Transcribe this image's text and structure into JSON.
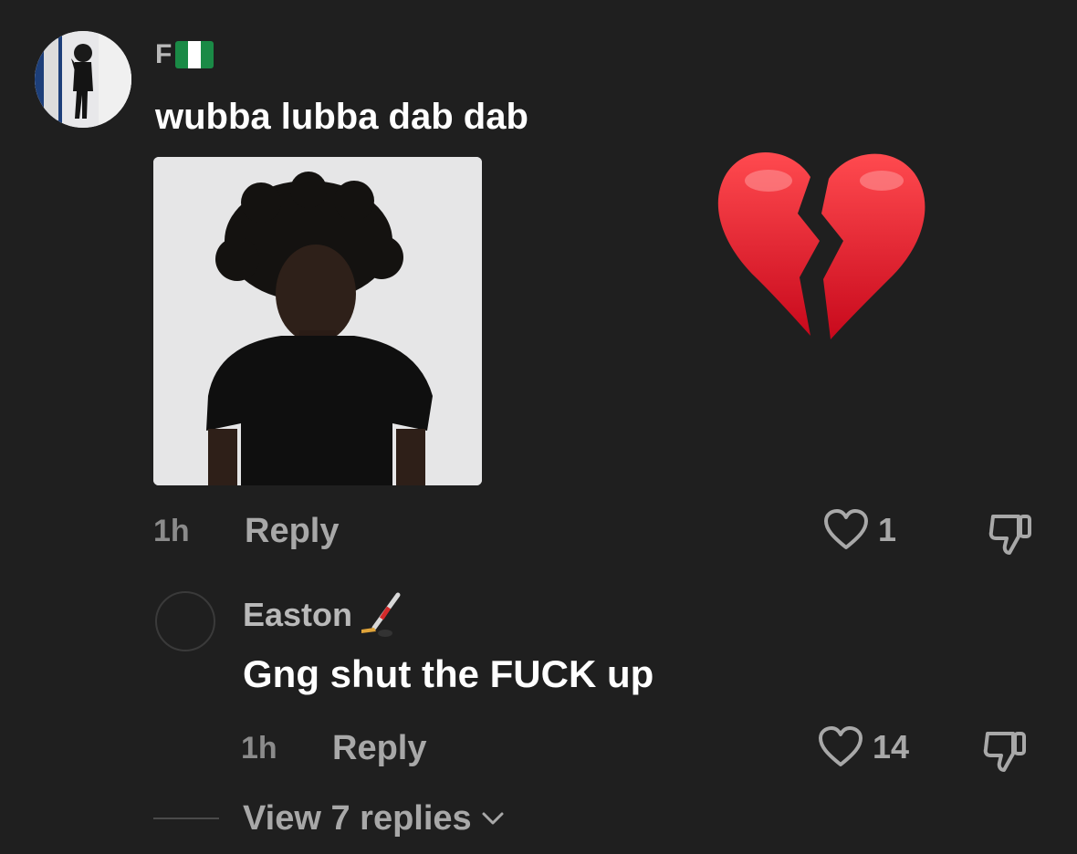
{
  "comment": {
    "avatar_icon": "user-avatar-photo",
    "username": "F",
    "username_flag": "nigeria-flag-icon",
    "flag_colors": [
      "#1a8a46",
      "#ffffff",
      "#1a8a46"
    ],
    "text": "wubba lubba dab dab",
    "attached_image": "photo-person-black-tshirt",
    "reaction_emoji": "broken-heart-icon",
    "time": "1h",
    "reply_label": "Reply",
    "like_count": "1"
  },
  "reply": {
    "avatar_icon": "empty-avatar-icon",
    "username": "Easton",
    "username_emoji": "hockey-stick-icon",
    "text": "Gng shut the FUCK up",
    "time": "1h",
    "reply_label": "Reply",
    "like_count": "14"
  },
  "view_replies_label": "View 7 replies",
  "colors": {
    "background": "#1f1f1f",
    "muted_text": "#a8a8a8",
    "primary_text": "#ffffff",
    "heart_red": "#e5122a"
  }
}
